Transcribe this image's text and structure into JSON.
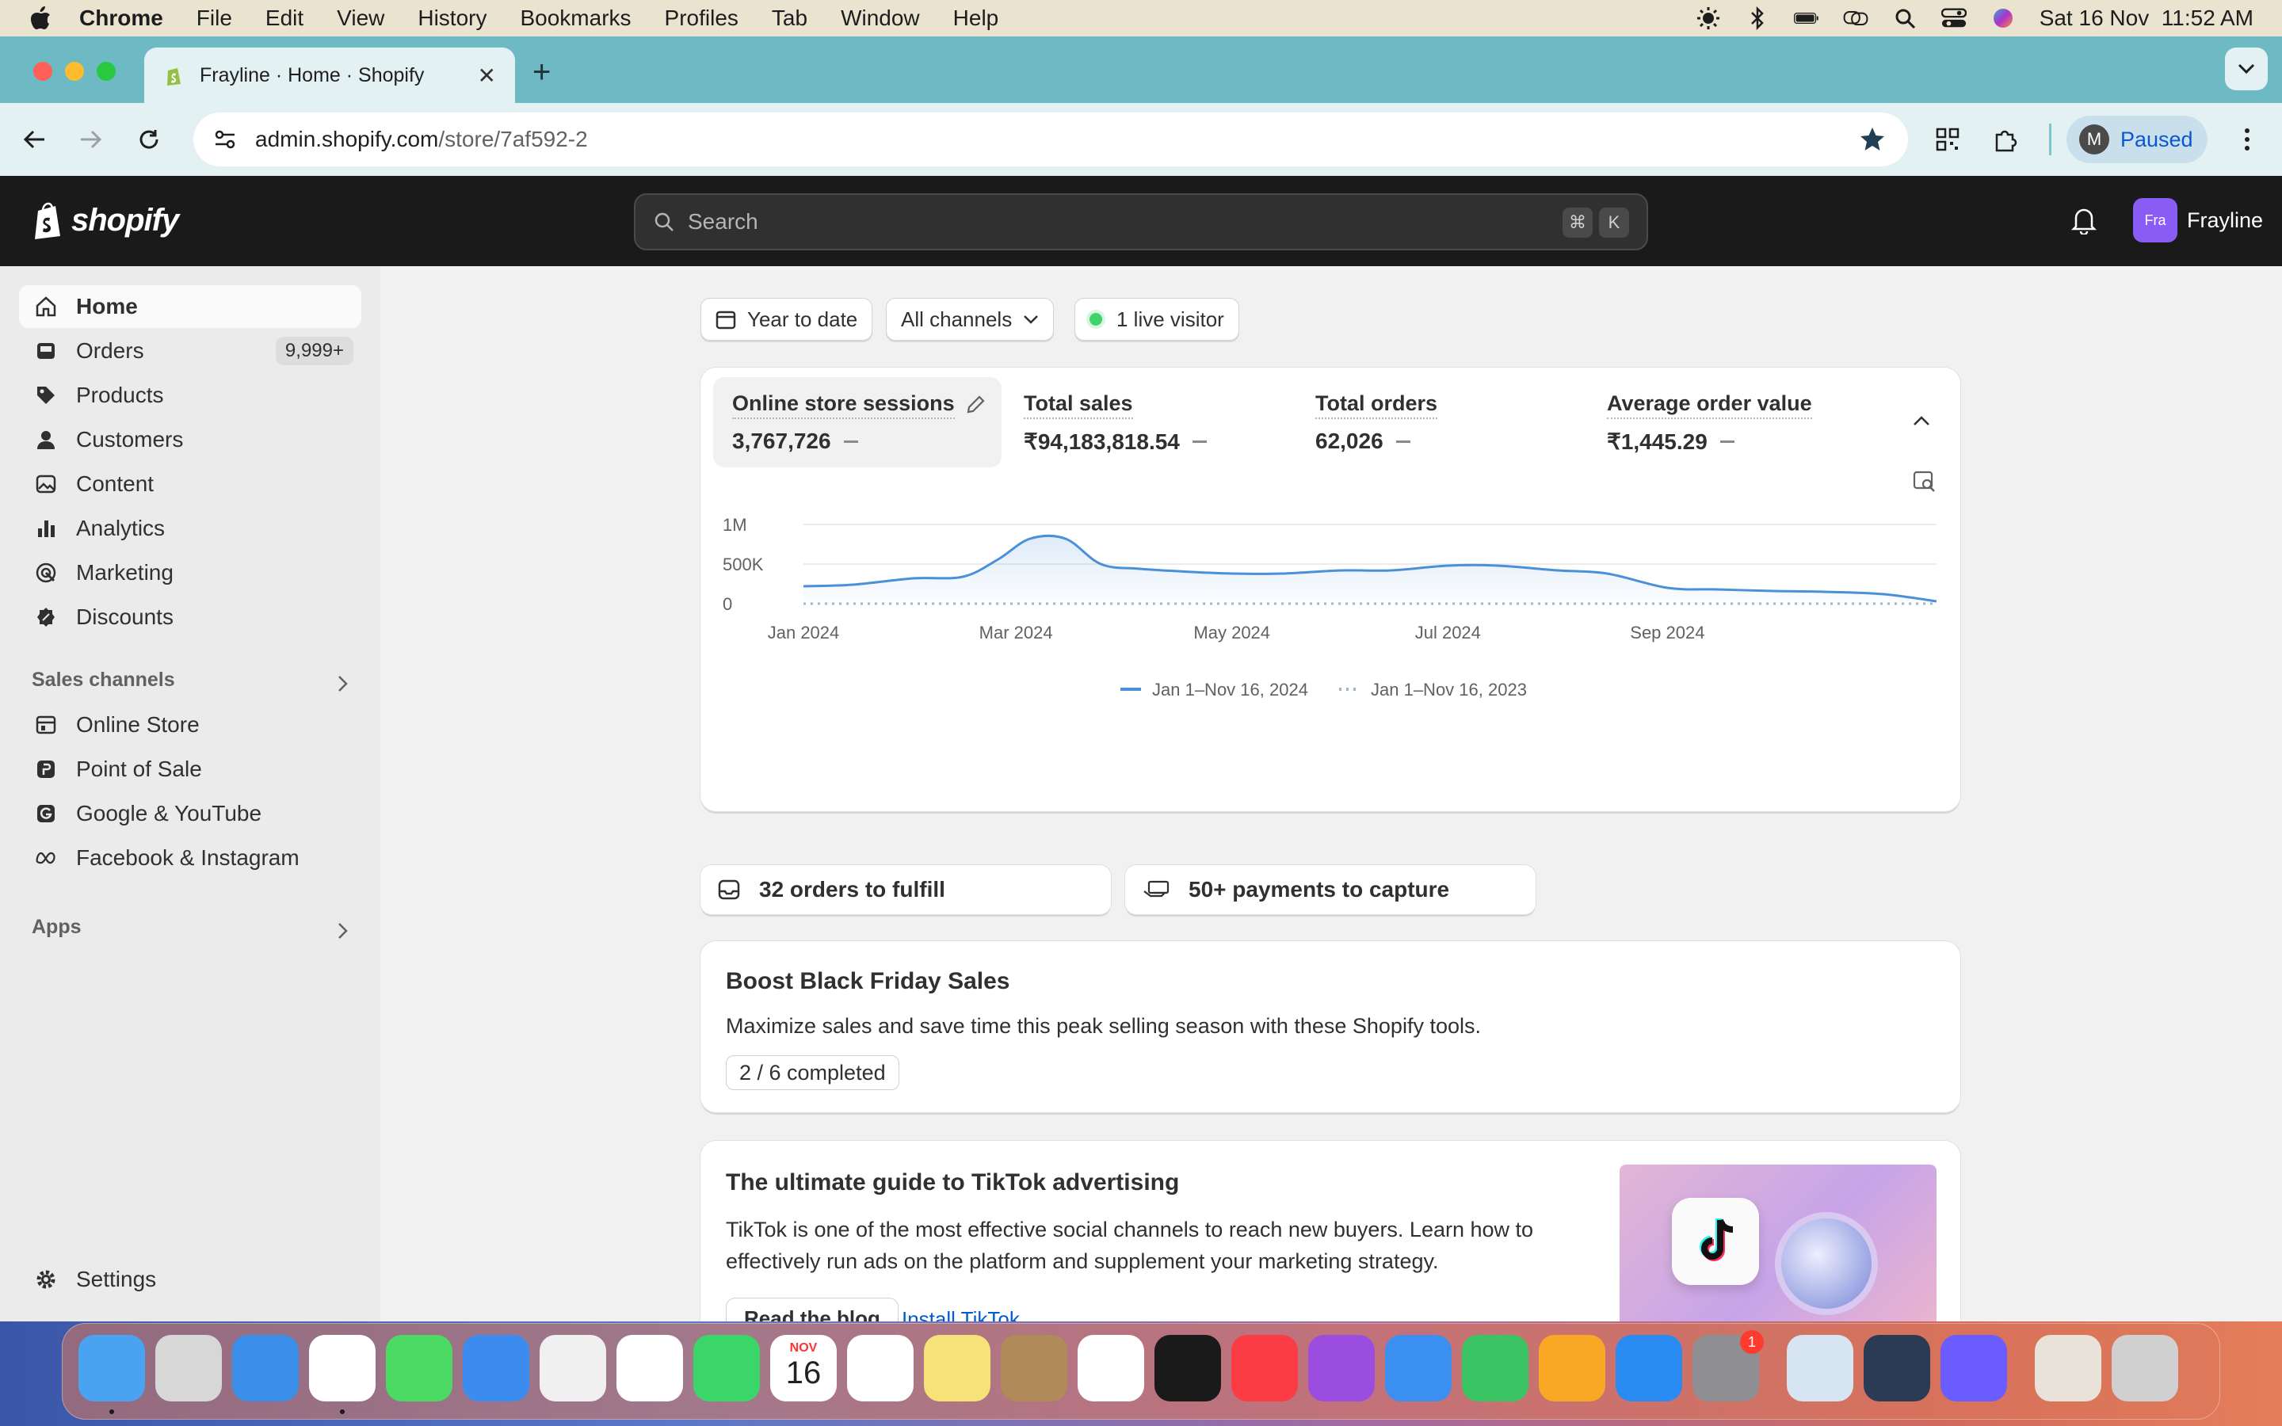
{
  "menubar": {
    "app": "Chrome",
    "items": [
      "File",
      "Edit",
      "View",
      "History",
      "Bookmarks",
      "Profiles",
      "Tab",
      "Window",
      "Help"
    ],
    "datetime": "Sat 16 Nov  11:52 AM"
  },
  "browser": {
    "tab_title": "Frayline · Home · Shopify",
    "url_host": "admin.shopify.com",
    "url_path": "/store/7af592-2",
    "profile_initial": "M",
    "profile_status": "Paused"
  },
  "shopify": {
    "logo_text": "shopify",
    "search_placeholder": "Search",
    "shortcut_cmd": "⌘",
    "shortcut_key": "K",
    "store_avatar": "Fra",
    "store_name": "Frayline"
  },
  "sidebar": {
    "items": [
      {
        "label": "Home",
        "icon": "home-icon"
      },
      {
        "label": "Orders",
        "icon": "orders-icon",
        "badge": "9,999+"
      },
      {
        "label": "Products",
        "icon": "tag-icon"
      },
      {
        "label": "Customers",
        "icon": "person-icon"
      },
      {
        "label": "Content",
        "icon": "image-icon"
      },
      {
        "label": "Analytics",
        "icon": "bar-chart-icon"
      },
      {
        "label": "Marketing",
        "icon": "target-icon"
      },
      {
        "label": "Discounts",
        "icon": "discount-icon"
      }
    ],
    "sales_channels_heading": "Sales channels",
    "channels": [
      {
        "label": "Online Store",
        "icon": "store-icon"
      },
      {
        "label": "Point of Sale",
        "icon": "pos-icon"
      },
      {
        "label": "Google & YouTube",
        "icon": "google-icon"
      },
      {
        "label": "Facebook & Instagram",
        "icon": "meta-icon"
      }
    ],
    "apps_heading": "Apps",
    "settings": "Settings"
  },
  "filters": {
    "date_range": "Year to date",
    "channels": "All channels",
    "live_visitors": "1 live visitor"
  },
  "metrics": [
    {
      "label": "Online store sessions",
      "value": "3,767,726"
    },
    {
      "label": "Total sales",
      "value": "₹94,183,818.54"
    },
    {
      "label": "Total orders",
      "value": "62,026"
    },
    {
      "label": "Average order value",
      "value": "₹1,445.29"
    }
  ],
  "chart_data": {
    "type": "line",
    "title": "",
    "xlabel": "",
    "ylabel": "",
    "y_ticks": [
      "0",
      "500K",
      "1M"
    ],
    "x_ticks": [
      "Jan 2024",
      "Mar 2024",
      "May 2024",
      "Jul 2024",
      "Sep 2024"
    ],
    "ylim": [
      0,
      1000000
    ],
    "x": [
      "2024-01-01",
      "2024-01-15",
      "2024-02-01",
      "2024-02-15",
      "2024-02-25",
      "2024-03-05",
      "2024-03-15",
      "2024-03-25",
      "2024-04-05",
      "2024-04-20",
      "2024-05-01",
      "2024-05-15",
      "2024-06-01",
      "2024-06-15",
      "2024-07-01",
      "2024-07-15",
      "2024-08-01",
      "2024-08-15",
      "2024-09-01",
      "2024-09-15",
      "2024-10-01",
      "2024-10-15",
      "2024-11-01",
      "2024-11-16"
    ],
    "series": [
      {
        "name": "Jan 1–Nov 16, 2024",
        "style": "solid",
        "color": "#4a90d9",
        "values": [
          220000,
          240000,
          320000,
          340000,
          560000,
          820000,
          820000,
          500000,
          440000,
          400000,
          380000,
          380000,
          420000,
          420000,
          480000,
          480000,
          420000,
          380000,
          200000,
          180000,
          160000,
          150000,
          120000,
          30000
        ]
      },
      {
        "name": "Jan 1–Nov 16, 2023",
        "style": "dotted",
        "color": "#9fb6c9",
        "values": [
          0,
          0,
          0,
          0,
          0,
          0,
          0,
          0,
          0,
          0,
          0,
          0,
          0,
          0,
          0,
          0,
          0,
          0,
          0,
          0,
          0,
          0,
          0,
          0
        ]
      }
    ],
    "legend_position": "bottom",
    "grid": true
  },
  "tasks": [
    {
      "label": "32 orders to fulfill",
      "icon": "inbox-icon"
    },
    {
      "label": "50+ payments to capture",
      "icon": "payment-hand-icon"
    }
  ],
  "bfcm_card": {
    "title": "Boost Black Friday Sales",
    "body": "Maximize sales and save time this peak selling season with these Shopify tools.",
    "progress_label": "2 / 6 completed",
    "completed": 2,
    "total": 6
  },
  "tiktok_card": {
    "title": "The ultimate guide to TikTok advertising",
    "body_line1": "TikTok is one of the most effective social channels to reach new buyers. Learn how to",
    "body_line2": "effectively run ads on the platform and supplement your marketing strategy.",
    "primary_button": "Read the blog",
    "secondary_link": "Install TikTok"
  },
  "dock": {
    "calendar_month": "NOV",
    "calendar_day": "16",
    "settings_badge": "1",
    "apps": [
      "finder-icon",
      "launchpad-icon",
      "safari-icon",
      "chrome-icon",
      "messages-icon",
      "mail-icon",
      "maps-icon",
      "photos-icon",
      "facetime-icon",
      "calendar-icon",
      "reminders-icon",
      "notes-icon",
      "contacts-icon",
      "freeform-icon",
      "tv-icon",
      "music-icon",
      "podcasts-icon",
      "keynote-icon",
      "numbers-icon",
      "pages-icon",
      "app-store-icon",
      "system-settings-icon",
      "preview-icon",
      "quicktime-icon",
      "perplexity-icon",
      "document-icon",
      "trash-icon"
    ]
  }
}
